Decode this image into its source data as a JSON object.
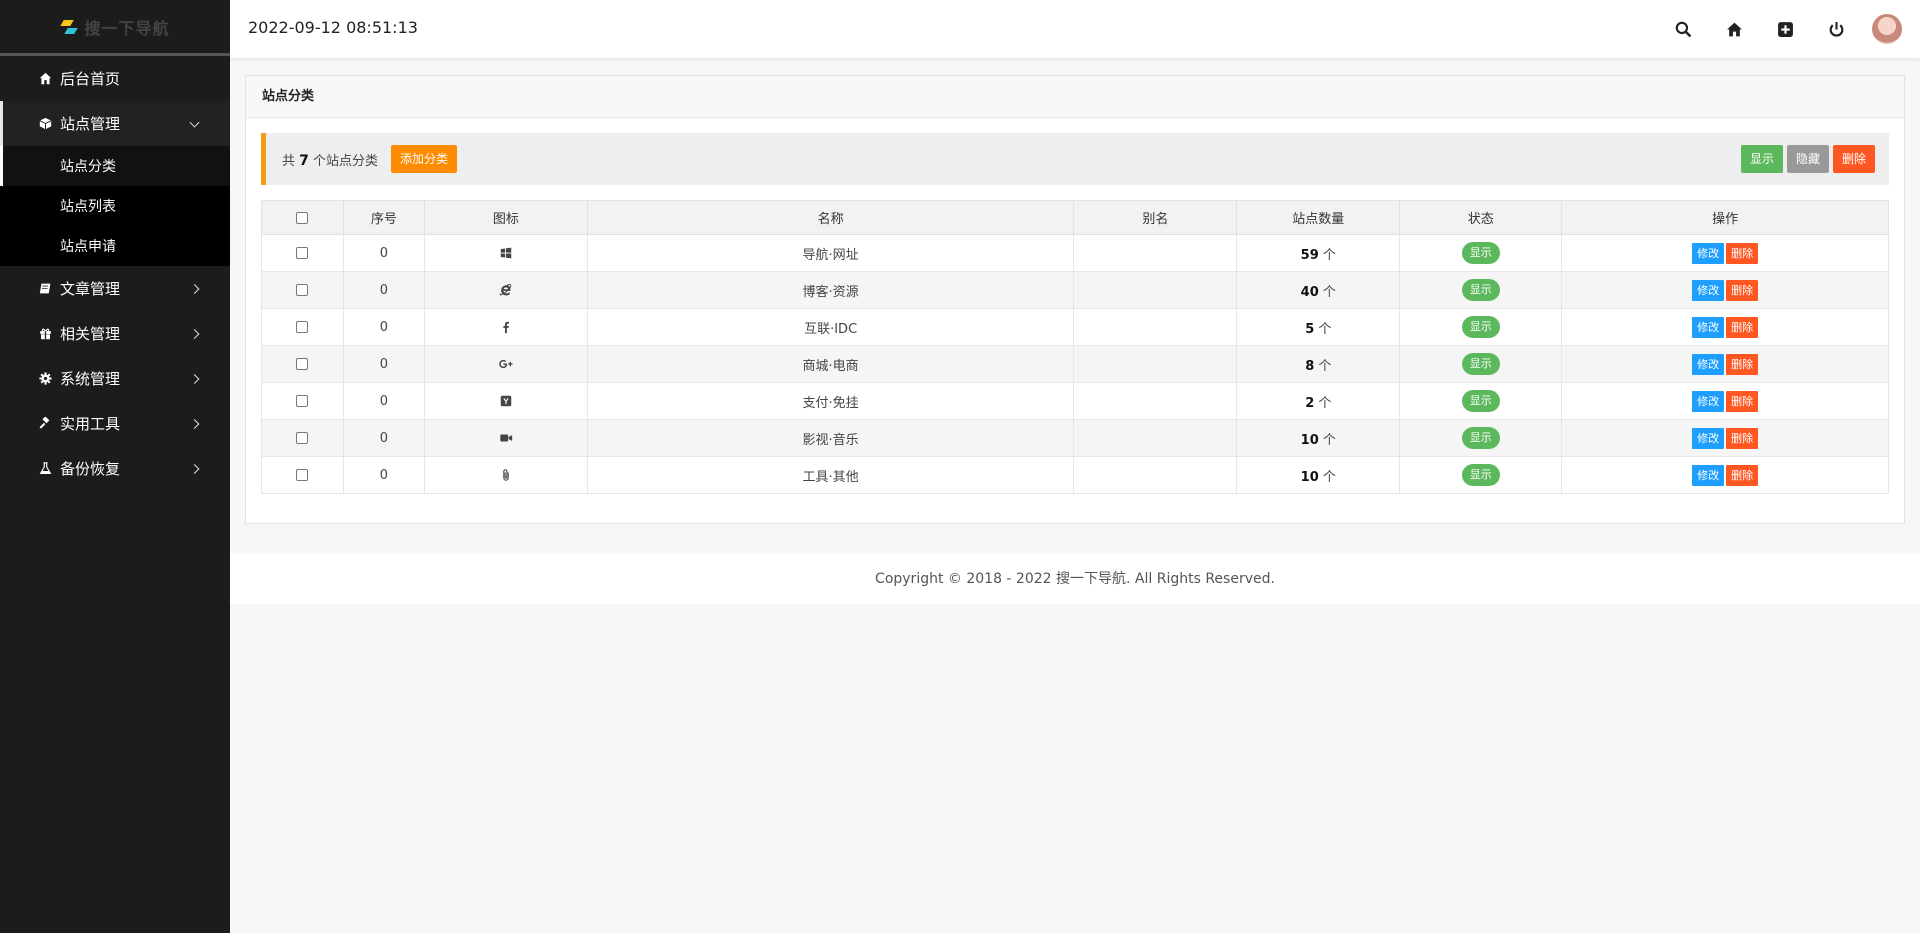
{
  "logo": {
    "text": "搜一下导航"
  },
  "header": {
    "datetime": "2022-09-12 08:51:13"
  },
  "sidebar": {
    "items": [
      {
        "label": "后台首页",
        "icon": "home-icon"
      },
      {
        "label": "站点管理",
        "icon": "cube-icon",
        "open": true,
        "children": [
          {
            "label": "站点分类",
            "active": true
          },
          {
            "label": "站点列表"
          },
          {
            "label": "站点申请"
          }
        ]
      },
      {
        "label": "文章管理",
        "icon": "book-icon"
      },
      {
        "label": "相关管理",
        "icon": "gift-icon"
      },
      {
        "label": "系统管理",
        "icon": "gear-icon"
      },
      {
        "label": "实用工具",
        "icon": "gavel-icon"
      },
      {
        "label": "备份恢复",
        "icon": "flask-icon"
      }
    ]
  },
  "panel": {
    "title": "站点分类",
    "toolbar": {
      "count_prefix": "共",
      "count": "7",
      "count_suffix": "个站点分类",
      "add_label": "添加分类",
      "show_label": "显示",
      "hide_label": "隐藏",
      "delete_label": "删除"
    },
    "table": {
      "headers": [
        "序号",
        "图标",
        "名称",
        "别名",
        "站点数量",
        "状态",
        "操作"
      ],
      "unit": "个",
      "edit_label": "修改",
      "delete_label": "删除",
      "rows": [
        {
          "order": "0",
          "icon": "windows-icon",
          "name": "导航·网址",
          "alias": "",
          "count": "59",
          "status": "显示"
        },
        {
          "order": "0",
          "icon": "internet-explorer-icon",
          "name": "博客·资源",
          "alias": "",
          "count": "40",
          "status": "显示"
        },
        {
          "order": "0",
          "icon": "facebook-icon",
          "name": "互联·IDC",
          "alias": "",
          "count": "5",
          "status": "显示"
        },
        {
          "order": "0",
          "icon": "google-plus-icon",
          "name": "商城·电商",
          "alias": "",
          "count": "8",
          "status": "显示"
        },
        {
          "order": "0",
          "icon": "yahoo-square-icon",
          "name": "支付·免挂",
          "alias": "",
          "count": "2",
          "status": "显示"
        },
        {
          "order": "0",
          "icon": "video-camera-icon",
          "name": "影视·音乐",
          "alias": "",
          "count": "10",
          "status": "显示"
        },
        {
          "order": "0",
          "icon": "paperclip-icon",
          "name": "工具·其他",
          "alias": "",
          "count": "10",
          "status": "显示"
        }
      ]
    }
  },
  "footer": {
    "text": "Copyright © 2018 - 2022 搜一下导航. All Rights Reserved."
  },
  "colors": {
    "sidebar_bg": "#1c1c1c",
    "accent_orange": "#ff8c00",
    "green": "#5cb85c",
    "blue": "#1e9fff",
    "red": "#ff5722"
  }
}
